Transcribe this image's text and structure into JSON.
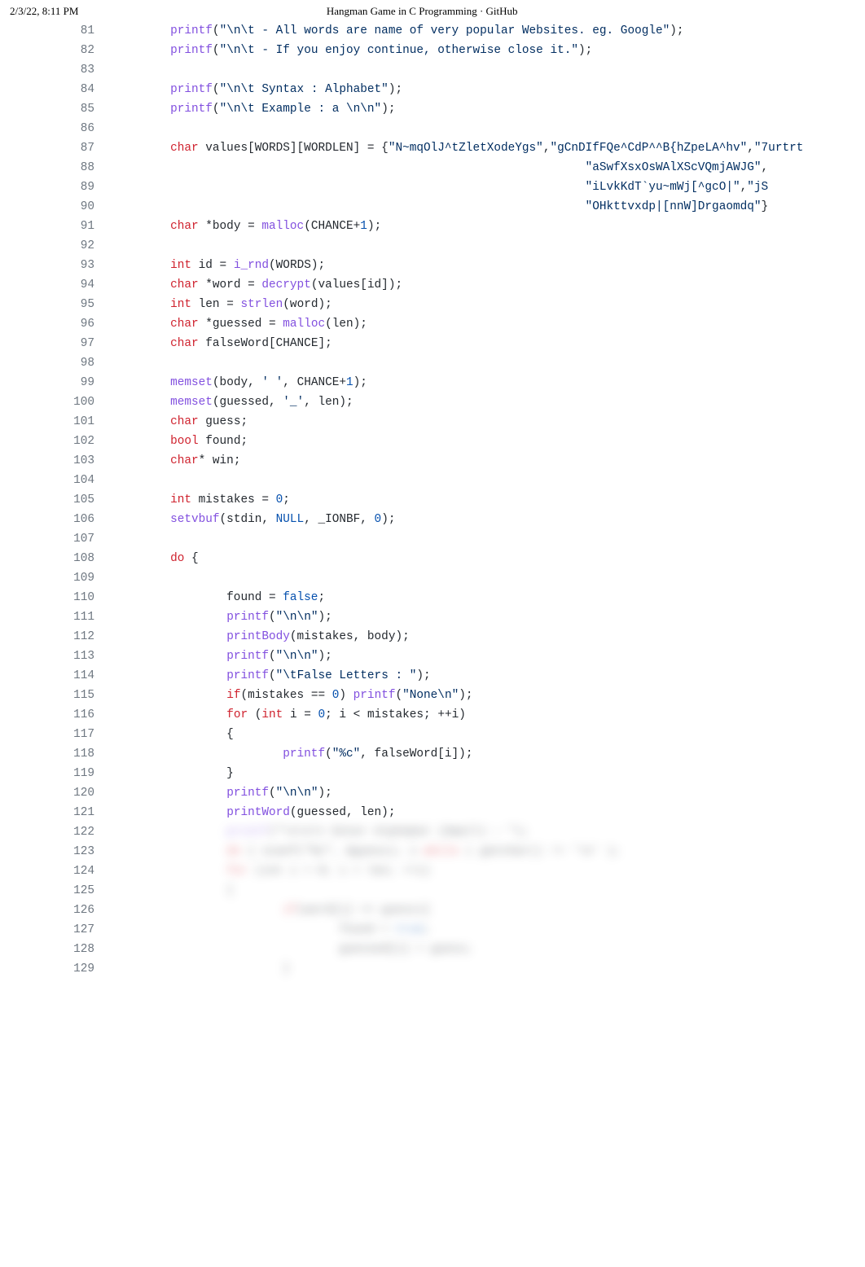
{
  "header": {
    "timestamp": "2/3/22, 8:11 PM",
    "title": "Hangman Game in C Programming · GitHub"
  },
  "lines": [
    {
      "n": 81,
      "tokens": [
        {
          "t": "        "
        },
        {
          "t": "printf",
          "c": "fn"
        },
        {
          "t": "("
        },
        {
          "t": "\"\\n\\t - All words are name of very popular Websites. eg. Google\"",
          "c": "str"
        },
        {
          "t": ");"
        }
      ]
    },
    {
      "n": 82,
      "tokens": [
        {
          "t": "        "
        },
        {
          "t": "printf",
          "c": "fn"
        },
        {
          "t": "("
        },
        {
          "t": "\"\\n\\t - If you enjoy continue, otherwise close it.\"",
          "c": "str"
        },
        {
          "t": ");"
        }
      ]
    },
    {
      "n": 83,
      "tokens": []
    },
    {
      "n": 84,
      "tokens": [
        {
          "t": "        "
        },
        {
          "t": "printf",
          "c": "fn"
        },
        {
          "t": "("
        },
        {
          "t": "\"\\n\\t Syntax : Alphabet\"",
          "c": "str"
        },
        {
          "t": ");"
        }
      ]
    },
    {
      "n": 85,
      "tokens": [
        {
          "t": "        "
        },
        {
          "t": "printf",
          "c": "fn"
        },
        {
          "t": "("
        },
        {
          "t": "\"\\n\\t Example : a \\n\\n\"",
          "c": "str"
        },
        {
          "t": ");"
        }
      ]
    },
    {
      "n": 86,
      "tokens": []
    },
    {
      "n": 87,
      "tokens": [
        {
          "t": "        "
        },
        {
          "t": "char",
          "c": "kw"
        },
        {
          "t": " values[WORDS][WORDLEN] = {"
        },
        {
          "t": "\"N~mqOlJ^tZletXodeYgs\"",
          "c": "str"
        },
        {
          "t": ","
        },
        {
          "t": "\"gCnDIfFQe^CdP^^B{hZpeLA^hv\"",
          "c": "str"
        },
        {
          "t": ","
        },
        {
          "t": "\"7urtrt",
          "c": "str"
        }
      ]
    },
    {
      "n": 88,
      "tokens": [
        {
          "t": "                                                                   "
        },
        {
          "t": "\"aSwfXsxOsWAlXScVQmjAWJG\"",
          "c": "str"
        },
        {
          "t": ","
        }
      ]
    },
    {
      "n": 89,
      "tokens": [
        {
          "t": "                                                                   "
        },
        {
          "t": "\"iLvkKdT`yu~mWj[^gcO|\"",
          "c": "str"
        },
        {
          "t": ","
        },
        {
          "t": "\"jS",
          "c": "str"
        }
      ]
    },
    {
      "n": 90,
      "tokens": [
        {
          "t": "                                                                   "
        },
        {
          "t": "\"OHkttvxdp|[nnW]Drgaomdq\"",
          "c": "str"
        },
        {
          "t": "}"
        }
      ]
    },
    {
      "n": 91,
      "tokens": [
        {
          "t": "        "
        },
        {
          "t": "char",
          "c": "kw"
        },
        {
          "t": " *body = "
        },
        {
          "t": "malloc",
          "c": "fn"
        },
        {
          "t": "(CHANCE+"
        },
        {
          "t": "1",
          "c": "num"
        },
        {
          "t": ");"
        }
      ]
    },
    {
      "n": 92,
      "tokens": []
    },
    {
      "n": 93,
      "tokens": [
        {
          "t": "        "
        },
        {
          "t": "int",
          "c": "kw"
        },
        {
          "t": " id = "
        },
        {
          "t": "i_rnd",
          "c": "fn"
        },
        {
          "t": "(WORDS);"
        }
      ]
    },
    {
      "n": 94,
      "tokens": [
        {
          "t": "        "
        },
        {
          "t": "char",
          "c": "kw"
        },
        {
          "t": " *word = "
        },
        {
          "t": "decrypt",
          "c": "fn"
        },
        {
          "t": "(values[id]);"
        }
      ]
    },
    {
      "n": 95,
      "tokens": [
        {
          "t": "        "
        },
        {
          "t": "int",
          "c": "kw"
        },
        {
          "t": " len = "
        },
        {
          "t": "strlen",
          "c": "fn"
        },
        {
          "t": "(word);"
        }
      ]
    },
    {
      "n": 96,
      "tokens": [
        {
          "t": "        "
        },
        {
          "t": "char",
          "c": "kw"
        },
        {
          "t": " *guessed = "
        },
        {
          "t": "malloc",
          "c": "fn"
        },
        {
          "t": "(len);"
        }
      ]
    },
    {
      "n": 97,
      "tokens": [
        {
          "t": "        "
        },
        {
          "t": "char",
          "c": "kw"
        },
        {
          "t": " falseWord[CHANCE];"
        }
      ]
    },
    {
      "n": 98,
      "tokens": []
    },
    {
      "n": 99,
      "tokens": [
        {
          "t": "        "
        },
        {
          "t": "memset",
          "c": "fn"
        },
        {
          "t": "(body, "
        },
        {
          "t": "' '",
          "c": "str"
        },
        {
          "t": ", CHANCE+"
        },
        {
          "t": "1",
          "c": "num"
        },
        {
          "t": ");"
        }
      ]
    },
    {
      "n": 100,
      "tokens": [
        {
          "t": "        "
        },
        {
          "t": "memset",
          "c": "fn"
        },
        {
          "t": "(guessed, "
        },
        {
          "t": "'_'",
          "c": "str"
        },
        {
          "t": ", len);"
        }
      ]
    },
    {
      "n": 101,
      "tokens": [
        {
          "t": "        "
        },
        {
          "t": "char",
          "c": "kw"
        },
        {
          "t": " guess;"
        }
      ]
    },
    {
      "n": 102,
      "tokens": [
        {
          "t": "        "
        },
        {
          "t": "bool",
          "c": "kw"
        },
        {
          "t": " found;"
        }
      ]
    },
    {
      "n": 103,
      "tokens": [
        {
          "t": "        "
        },
        {
          "t": "char",
          "c": "kw"
        },
        {
          "t": "* win;"
        }
      ]
    },
    {
      "n": 104,
      "tokens": []
    },
    {
      "n": 105,
      "tokens": [
        {
          "t": "        "
        },
        {
          "t": "int",
          "c": "kw"
        },
        {
          "t": " mistakes = "
        },
        {
          "t": "0",
          "c": "num"
        },
        {
          "t": ";"
        }
      ]
    },
    {
      "n": 106,
      "tokens": [
        {
          "t": "        "
        },
        {
          "t": "setvbuf",
          "c": "fn"
        },
        {
          "t": "(stdin, "
        },
        {
          "t": "NULL",
          "c": "num"
        },
        {
          "t": ", _IONBF, "
        },
        {
          "t": "0",
          "c": "num"
        },
        {
          "t": ");"
        }
      ]
    },
    {
      "n": 107,
      "tokens": []
    },
    {
      "n": 108,
      "tokens": [
        {
          "t": "        "
        },
        {
          "t": "do",
          "c": "kw"
        },
        {
          "t": " {"
        }
      ]
    },
    {
      "n": 109,
      "tokens": []
    },
    {
      "n": 110,
      "tokens": [
        {
          "t": "                found = "
        },
        {
          "t": "false",
          "c": "num"
        },
        {
          "t": ";"
        }
      ]
    },
    {
      "n": 111,
      "tokens": [
        {
          "t": "                "
        },
        {
          "t": "printf",
          "c": "fn"
        },
        {
          "t": "("
        },
        {
          "t": "\"\\n\\n\"",
          "c": "str"
        },
        {
          "t": ");"
        }
      ]
    },
    {
      "n": 112,
      "tokens": [
        {
          "t": "                "
        },
        {
          "t": "printBody",
          "c": "fn"
        },
        {
          "t": "(mistakes, body);"
        }
      ]
    },
    {
      "n": 113,
      "tokens": [
        {
          "t": "                "
        },
        {
          "t": "printf",
          "c": "fn"
        },
        {
          "t": "("
        },
        {
          "t": "\"\\n\\n\"",
          "c": "str"
        },
        {
          "t": ");"
        }
      ]
    },
    {
      "n": 114,
      "tokens": [
        {
          "t": "                "
        },
        {
          "t": "printf",
          "c": "fn"
        },
        {
          "t": "("
        },
        {
          "t": "\"\\tFalse Letters : \"",
          "c": "str"
        },
        {
          "t": ");"
        }
      ]
    },
    {
      "n": 115,
      "tokens": [
        {
          "t": "                "
        },
        {
          "t": "if",
          "c": "kw"
        },
        {
          "t": "(mistakes == "
        },
        {
          "t": "0",
          "c": "num"
        },
        {
          "t": ") "
        },
        {
          "t": "printf",
          "c": "fn"
        },
        {
          "t": "("
        },
        {
          "t": "\"None\\n\"",
          "c": "str"
        },
        {
          "t": ");"
        }
      ]
    },
    {
      "n": 116,
      "tokens": [
        {
          "t": "                "
        },
        {
          "t": "for",
          "c": "kw"
        },
        {
          "t": " ("
        },
        {
          "t": "int",
          "c": "kw"
        },
        {
          "t": " i = "
        },
        {
          "t": "0",
          "c": "num"
        },
        {
          "t": "; i < mistakes; ++i)"
        }
      ]
    },
    {
      "n": 117,
      "tokens": [
        {
          "t": "                {"
        }
      ]
    },
    {
      "n": 118,
      "tokens": [
        {
          "t": "                        "
        },
        {
          "t": "printf",
          "c": "fn"
        },
        {
          "t": "("
        },
        {
          "t": "\"%c\"",
          "c": "str"
        },
        {
          "t": ", falseWord[i]);"
        }
      ]
    },
    {
      "n": 119,
      "tokens": [
        {
          "t": "                }"
        }
      ]
    },
    {
      "n": 120,
      "tokens": [
        {
          "t": "                "
        },
        {
          "t": "printf",
          "c": "fn"
        },
        {
          "t": "("
        },
        {
          "t": "\"\\n\\n\"",
          "c": "str"
        },
        {
          "t": ");"
        }
      ]
    },
    {
      "n": 121,
      "tokens": [
        {
          "t": "                "
        },
        {
          "t": "printWord",
          "c": "fn"
        },
        {
          "t": "(guessed, len);"
        }
      ]
    },
    {
      "n": 122,
      "blur": true,
      "tokens": [
        {
          "t": "                "
        },
        {
          "t": "printf",
          "c": "fn"
        },
        {
          "t": "(\"\\n\\n\\t Enter Alphabet (Small) : \");"
        }
      ]
    },
    {
      "n": 123,
      "blur": true,
      "tokens": [
        {
          "t": "                "
        },
        {
          "t": "do",
          "c": "kw"
        },
        {
          "t": " { scanf(\"%c\", &guess); } "
        },
        {
          "t": "while",
          "c": "kw"
        },
        {
          "t": " ( getchar() != '\\n' );"
        }
      ]
    },
    {
      "n": 124,
      "blur": true,
      "tokens": [
        {
          "t": "                "
        },
        {
          "t": "for",
          "c": "kw"
        },
        {
          "t": " (int i = 0; i < len; ++i)"
        }
      ]
    },
    {
      "n": 125,
      "blur": true,
      "tokens": [
        {
          "t": "                {"
        }
      ]
    },
    {
      "n": 126,
      "blur": true,
      "tokens": [
        {
          "t": "                        "
        },
        {
          "t": "if",
          "c": "kw"
        },
        {
          "t": "(word[i] == guess){"
        }
      ]
    },
    {
      "n": 127,
      "blur": true,
      "tokens": [
        {
          "t": "                                found = "
        },
        {
          "t": "true",
          "c": "num"
        },
        {
          "t": ";"
        }
      ]
    },
    {
      "n": 128,
      "blur": true,
      "tokens": [
        {
          "t": "                                guessed[i] = guess;"
        }
      ]
    },
    {
      "n": 129,
      "blur": true,
      "tokens": [
        {
          "t": "                        }"
        }
      ]
    }
  ]
}
